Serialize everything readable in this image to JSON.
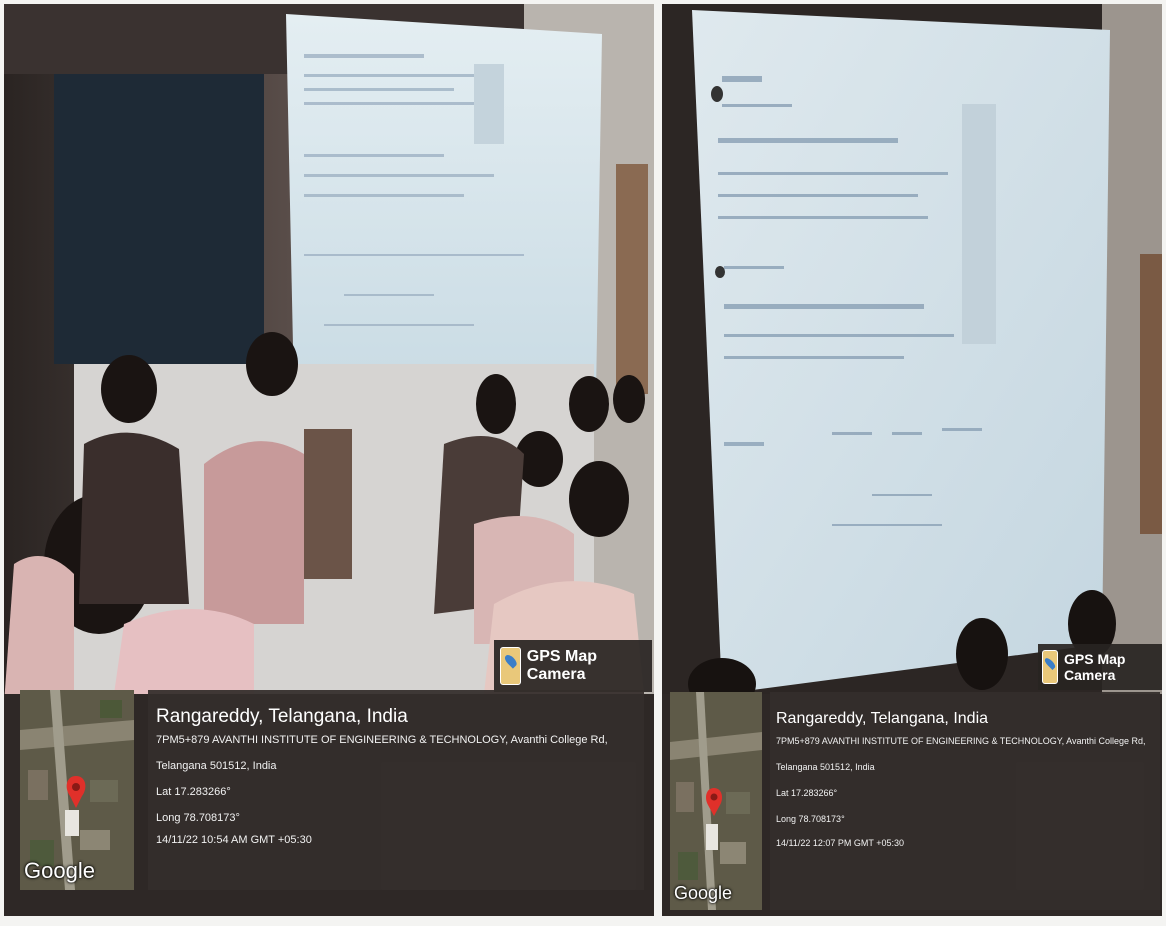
{
  "photos": [
    {
      "badge": "GPS Map Camera",
      "map_watermark": "Google",
      "place": "Rangareddy, Telangana, India",
      "address_line1": "7PM5+879 AVANTHI INSTITUTE OF ENGINEERING & TECHNOLOGY, Avanthi College Rd,",
      "address_line2": "Telangana 501512, India",
      "lat": "Lat 17.283266°",
      "long": "Long 78.708173°",
      "datetime": "14/11/22 10:54 AM GMT +05:30"
    },
    {
      "badge": "GPS Map Camera",
      "map_watermark": "Google",
      "place": "Rangareddy, Telangana, India",
      "address_line1": "7PM5+879 AVANTHI INSTITUTE OF ENGINEERING & TECHNOLOGY, Avanthi College Rd,",
      "address_line2": "Telangana 501512, India",
      "lat": "Lat 17.283266°",
      "long": "Long 78.708173°",
      "datetime": "14/11/22 12:07 PM GMT +05:30"
    }
  ],
  "colors": {
    "overlay": "#342e2c",
    "map_pin": "#e0302a",
    "badge_icon": "#e9c87a"
  },
  "icons": [
    "gps-camera-icon",
    "map-pin-icon"
  ]
}
